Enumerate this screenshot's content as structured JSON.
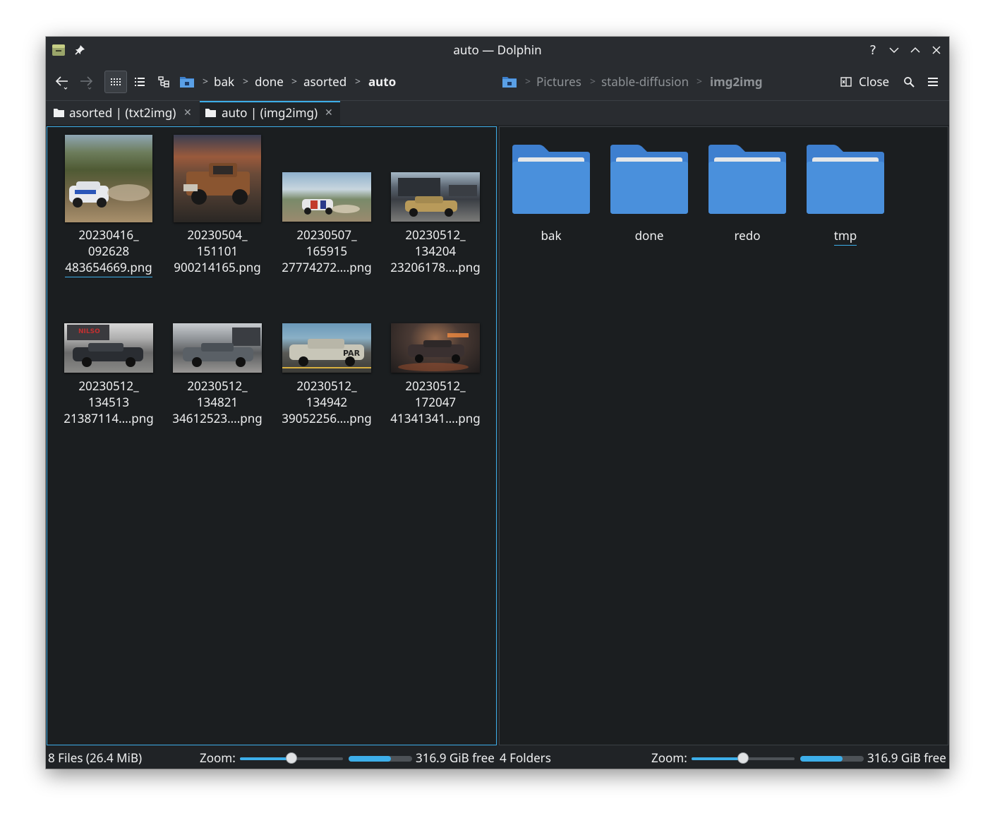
{
  "window": {
    "title": "auto — Dolphin"
  },
  "toolbar": {
    "location_left": [
      "bak",
      "done",
      "asorted",
      "auto"
    ],
    "location_right": [
      "Pictures",
      "stable-diffusion",
      "img2img"
    ],
    "close_label": "Close"
  },
  "tabs": [
    {
      "label": "asorted | (txt2img)",
      "active": false
    },
    {
      "label": "auto | (img2img)",
      "active": true
    }
  ],
  "left_pane": {
    "files": [
      {
        "line1": "20230416_",
        "line2": "092628",
        "line3": "483654669.png"
      },
      {
        "line1": "20230504_",
        "line2": "151101",
        "line3": "900214165.png"
      },
      {
        "line1": "20230507_",
        "line2": "165915",
        "line3": "27774272....png"
      },
      {
        "line1": "20230512_",
        "line2": "134204",
        "line3": "23206178....png"
      },
      {
        "line1": "20230512_",
        "line2": "134513",
        "line3": "21387114....png"
      },
      {
        "line1": "20230512_",
        "line2": "134821",
        "line3": "34612523....png"
      },
      {
        "line1": "20230512_",
        "line2": "134942",
        "line3": "39052256....png"
      },
      {
        "line1": "20230512_",
        "line2": "172047",
        "line3": "41341341....png"
      }
    ]
  },
  "right_pane": {
    "folders": [
      "bak",
      "done",
      "redo",
      "tmp"
    ]
  },
  "status_left": {
    "summary": "8 Files (26.4 MiB)",
    "zoom_label": "Zoom:",
    "free": "316.9 GiB free",
    "zoom_level": 0.5,
    "disk_used": 0.67
  },
  "status_right": {
    "summary": "4 Folders",
    "zoom_label": "Zoom:",
    "free": "316.9 GiB free",
    "zoom_level": 0.5,
    "disk_used": 0.67
  },
  "colors": {
    "accent": "#3daee9",
    "folder": "#4a90d9",
    "background": "#1b1e20"
  }
}
